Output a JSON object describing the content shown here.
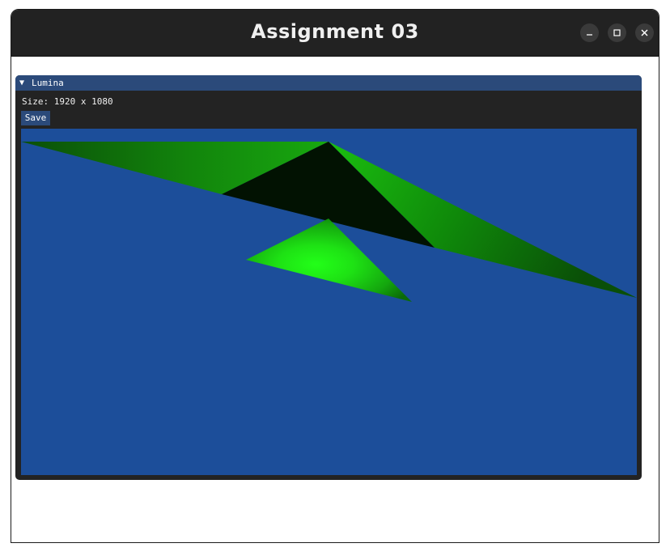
{
  "window": {
    "title": "Assignment 03",
    "controls": [
      "minimize-icon",
      "maximize-icon",
      "close-icon"
    ]
  },
  "panel": {
    "title": "Lumina",
    "collapse_icon": "triangle-down-icon",
    "info_text": "Size: 1920 x 1080",
    "save_label": "Save"
  },
  "render": {
    "background": "#1c4e9a",
    "triangle_colors": {
      "dark": "#021202",
      "mid": "#0f8a0a",
      "bright": "#1ef514",
      "shadow": "#0b5c0a"
    }
  }
}
